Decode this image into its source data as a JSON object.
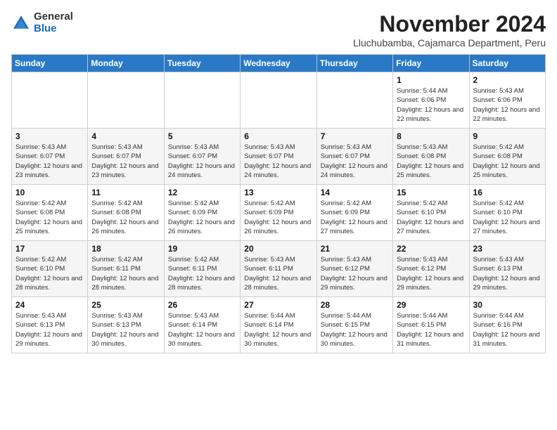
{
  "logo": {
    "general": "General",
    "blue": "Blue"
  },
  "title": "November 2024",
  "location": "Lluchubamba, Cajamarca Department, Peru",
  "days_of_week": [
    "Sunday",
    "Monday",
    "Tuesday",
    "Wednesday",
    "Thursday",
    "Friday",
    "Saturday"
  ],
  "weeks": [
    [
      {
        "day": "",
        "info": ""
      },
      {
        "day": "",
        "info": ""
      },
      {
        "day": "",
        "info": ""
      },
      {
        "day": "",
        "info": ""
      },
      {
        "day": "",
        "info": ""
      },
      {
        "day": "1",
        "info": "Sunrise: 5:44 AM\nSunset: 6:06 PM\nDaylight: 12 hours and 22 minutes."
      },
      {
        "day": "2",
        "info": "Sunrise: 5:43 AM\nSunset: 6:06 PM\nDaylight: 12 hours and 22 minutes."
      }
    ],
    [
      {
        "day": "3",
        "info": "Sunrise: 5:43 AM\nSunset: 6:07 PM\nDaylight: 12 hours and 23 minutes."
      },
      {
        "day": "4",
        "info": "Sunrise: 5:43 AM\nSunset: 6:07 PM\nDaylight: 12 hours and 23 minutes."
      },
      {
        "day": "5",
        "info": "Sunrise: 5:43 AM\nSunset: 6:07 PM\nDaylight: 12 hours and 24 minutes."
      },
      {
        "day": "6",
        "info": "Sunrise: 5:43 AM\nSunset: 6:07 PM\nDaylight: 12 hours and 24 minutes."
      },
      {
        "day": "7",
        "info": "Sunrise: 5:43 AM\nSunset: 6:07 PM\nDaylight: 12 hours and 24 minutes."
      },
      {
        "day": "8",
        "info": "Sunrise: 5:43 AM\nSunset: 6:08 PM\nDaylight: 12 hours and 25 minutes."
      },
      {
        "day": "9",
        "info": "Sunrise: 5:42 AM\nSunset: 6:08 PM\nDaylight: 12 hours and 25 minutes."
      }
    ],
    [
      {
        "day": "10",
        "info": "Sunrise: 5:42 AM\nSunset: 6:08 PM\nDaylight: 12 hours and 25 minutes."
      },
      {
        "day": "11",
        "info": "Sunrise: 5:42 AM\nSunset: 6:08 PM\nDaylight: 12 hours and 26 minutes."
      },
      {
        "day": "12",
        "info": "Sunrise: 5:42 AM\nSunset: 6:09 PM\nDaylight: 12 hours and 26 minutes."
      },
      {
        "day": "13",
        "info": "Sunrise: 5:42 AM\nSunset: 6:09 PM\nDaylight: 12 hours and 26 minutes."
      },
      {
        "day": "14",
        "info": "Sunrise: 5:42 AM\nSunset: 6:09 PM\nDaylight: 12 hours and 27 minutes."
      },
      {
        "day": "15",
        "info": "Sunrise: 5:42 AM\nSunset: 6:10 PM\nDaylight: 12 hours and 27 minutes."
      },
      {
        "day": "16",
        "info": "Sunrise: 5:42 AM\nSunset: 6:10 PM\nDaylight: 12 hours and 27 minutes."
      }
    ],
    [
      {
        "day": "17",
        "info": "Sunrise: 5:42 AM\nSunset: 6:10 PM\nDaylight: 12 hours and 28 minutes."
      },
      {
        "day": "18",
        "info": "Sunrise: 5:42 AM\nSunset: 6:11 PM\nDaylight: 12 hours and 28 minutes."
      },
      {
        "day": "19",
        "info": "Sunrise: 5:42 AM\nSunset: 6:11 PM\nDaylight: 12 hours and 28 minutes."
      },
      {
        "day": "20",
        "info": "Sunrise: 5:43 AM\nSunset: 6:11 PM\nDaylight: 12 hours and 28 minutes."
      },
      {
        "day": "21",
        "info": "Sunrise: 5:43 AM\nSunset: 6:12 PM\nDaylight: 12 hours and 29 minutes."
      },
      {
        "day": "22",
        "info": "Sunrise: 5:43 AM\nSunset: 6:12 PM\nDaylight: 12 hours and 29 minutes."
      },
      {
        "day": "23",
        "info": "Sunrise: 5:43 AM\nSunset: 6:13 PM\nDaylight: 12 hours and 29 minutes."
      }
    ],
    [
      {
        "day": "24",
        "info": "Sunrise: 5:43 AM\nSunset: 6:13 PM\nDaylight: 12 hours and 29 minutes."
      },
      {
        "day": "25",
        "info": "Sunrise: 5:43 AM\nSunset: 6:13 PM\nDaylight: 12 hours and 30 minutes."
      },
      {
        "day": "26",
        "info": "Sunrise: 5:43 AM\nSunset: 6:14 PM\nDaylight: 12 hours and 30 minutes."
      },
      {
        "day": "27",
        "info": "Sunrise: 5:44 AM\nSunset: 6:14 PM\nDaylight: 12 hours and 30 minutes."
      },
      {
        "day": "28",
        "info": "Sunrise: 5:44 AM\nSunset: 6:15 PM\nDaylight: 12 hours and 30 minutes."
      },
      {
        "day": "29",
        "info": "Sunrise: 5:44 AM\nSunset: 6:15 PM\nDaylight: 12 hours and 31 minutes."
      },
      {
        "day": "30",
        "info": "Sunrise: 5:44 AM\nSunset: 6:16 PM\nDaylight: 12 hours and 31 minutes."
      }
    ]
  ]
}
